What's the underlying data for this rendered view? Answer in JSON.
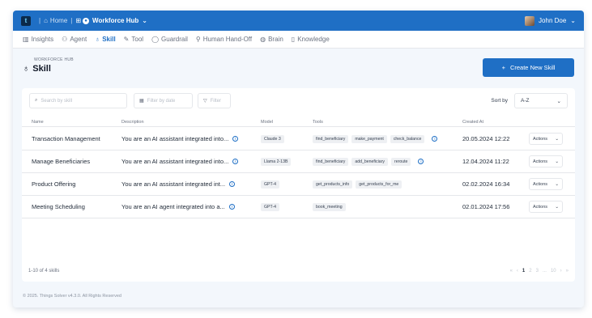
{
  "topbar": {
    "logo": "t",
    "home": "Home",
    "hub": "Workforce Hub",
    "user": "John Doe"
  },
  "tabs": [
    {
      "label": "Insights",
      "icon": "chart-icon"
    },
    {
      "label": "Agent",
      "icon": "agent-icon"
    },
    {
      "label": "Skill",
      "icon": "skill-icon"
    },
    {
      "label": "Tool",
      "icon": "tool-icon"
    },
    {
      "label": "Guardrail",
      "icon": "shield-icon"
    },
    {
      "label": "Human Hand-Off",
      "icon": "person-icon"
    },
    {
      "label": "Brain",
      "icon": "brain-icon"
    },
    {
      "label": "Knowledge",
      "icon": "book-icon"
    }
  ],
  "header": {
    "eyebrow": "WORKFORCE HUB",
    "title": "Skill"
  },
  "create_button": "Create New Skill",
  "filters": {
    "search_placeholder": "Search by skill",
    "date_placeholder": "Filter by date",
    "filter_label": "Filter",
    "sort_label": "Sort by",
    "sort_value": "A-Z"
  },
  "columns": [
    "Name",
    "Description",
    "Model",
    "Tools",
    "Created At"
  ],
  "rows": [
    {
      "name": "Transaction Management",
      "description": "You are an AI assistant integrated into...",
      "model": "Claude 3",
      "tools": [
        "find_beneficiary",
        "make_payment",
        "check_balance"
      ],
      "tools_more": true,
      "created": "20.05.2024 12:22",
      "actions": "Actions"
    },
    {
      "name": "Manage Beneficiaries",
      "description": "You are an AI assistant integrated into...",
      "model": "Llama 2-13B",
      "tools": [
        "find_beneficiary",
        "add_beneficiary",
        "reroute"
      ],
      "tools_more": true,
      "created": "12.04.2024 11:22",
      "actions": "Actions"
    },
    {
      "name": "Product Offering",
      "description": "You are an AI assistant integrated int...",
      "model": "GPT-4",
      "tools": [
        "get_products_info",
        "get_products_for_me"
      ],
      "tools_more": false,
      "created": "02.02.2024 16:34",
      "actions": "Actions"
    },
    {
      "name": "Meeting Scheduling",
      "description": "You are an AI agent integrated into a...",
      "model": "GPT-4",
      "tools": [
        "book_meeting"
      ],
      "tools_more": false,
      "created": "02.01.2024 17:56",
      "actions": "Actions"
    }
  ],
  "pagination": {
    "summary": "1-10 of 4 skills",
    "current": "1",
    "pages": [
      "2",
      "3",
      "...",
      "10"
    ]
  },
  "copyright": "© 2025. Things Solver v4.3.0. All Rights Reserved",
  "colors": {
    "primary": "#1f6fc5",
    "background": "#f3f7fc"
  }
}
